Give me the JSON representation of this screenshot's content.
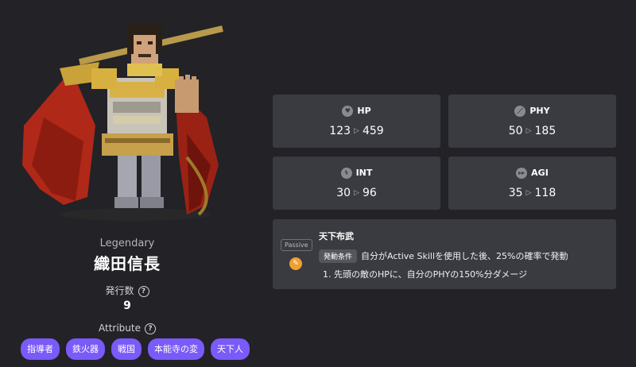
{
  "character": {
    "rarity": "Legendary",
    "name": "織田信長",
    "issue_label": "発行数",
    "issue_value": "9",
    "attribute_label": "Attribute",
    "help_glyph": "?"
  },
  "attributes": [
    "指導者",
    "鉄火器",
    "戦国",
    "本能寺の変",
    "天下人"
  ],
  "stats": {
    "hp": {
      "label": "HP",
      "base": "123",
      "max": "459",
      "icon": "heart-icon"
    },
    "phy": {
      "label": "PHY",
      "base": "50",
      "max": "185",
      "icon": "sword-icon"
    },
    "int": {
      "label": "INT",
      "base": "30",
      "max": "96",
      "icon": "lightning-icon"
    },
    "agi": {
      "label": "AGI",
      "base": "35",
      "max": "118",
      "icon": "fast-forward-icon"
    }
  },
  "skill": {
    "badge": "Passive",
    "name": "天下布武",
    "condition_label": "発動条件",
    "condition": "自分がActive Skillを使用した後、25%の確率で発動",
    "effect": "1. 先頭の敵のHPに、自分のPHYの150%分ダメージ"
  },
  "colors": {
    "background": "#222227",
    "card": "#3a3a41",
    "tag": "#7a5af8",
    "skill_icon": "#f0a030"
  }
}
